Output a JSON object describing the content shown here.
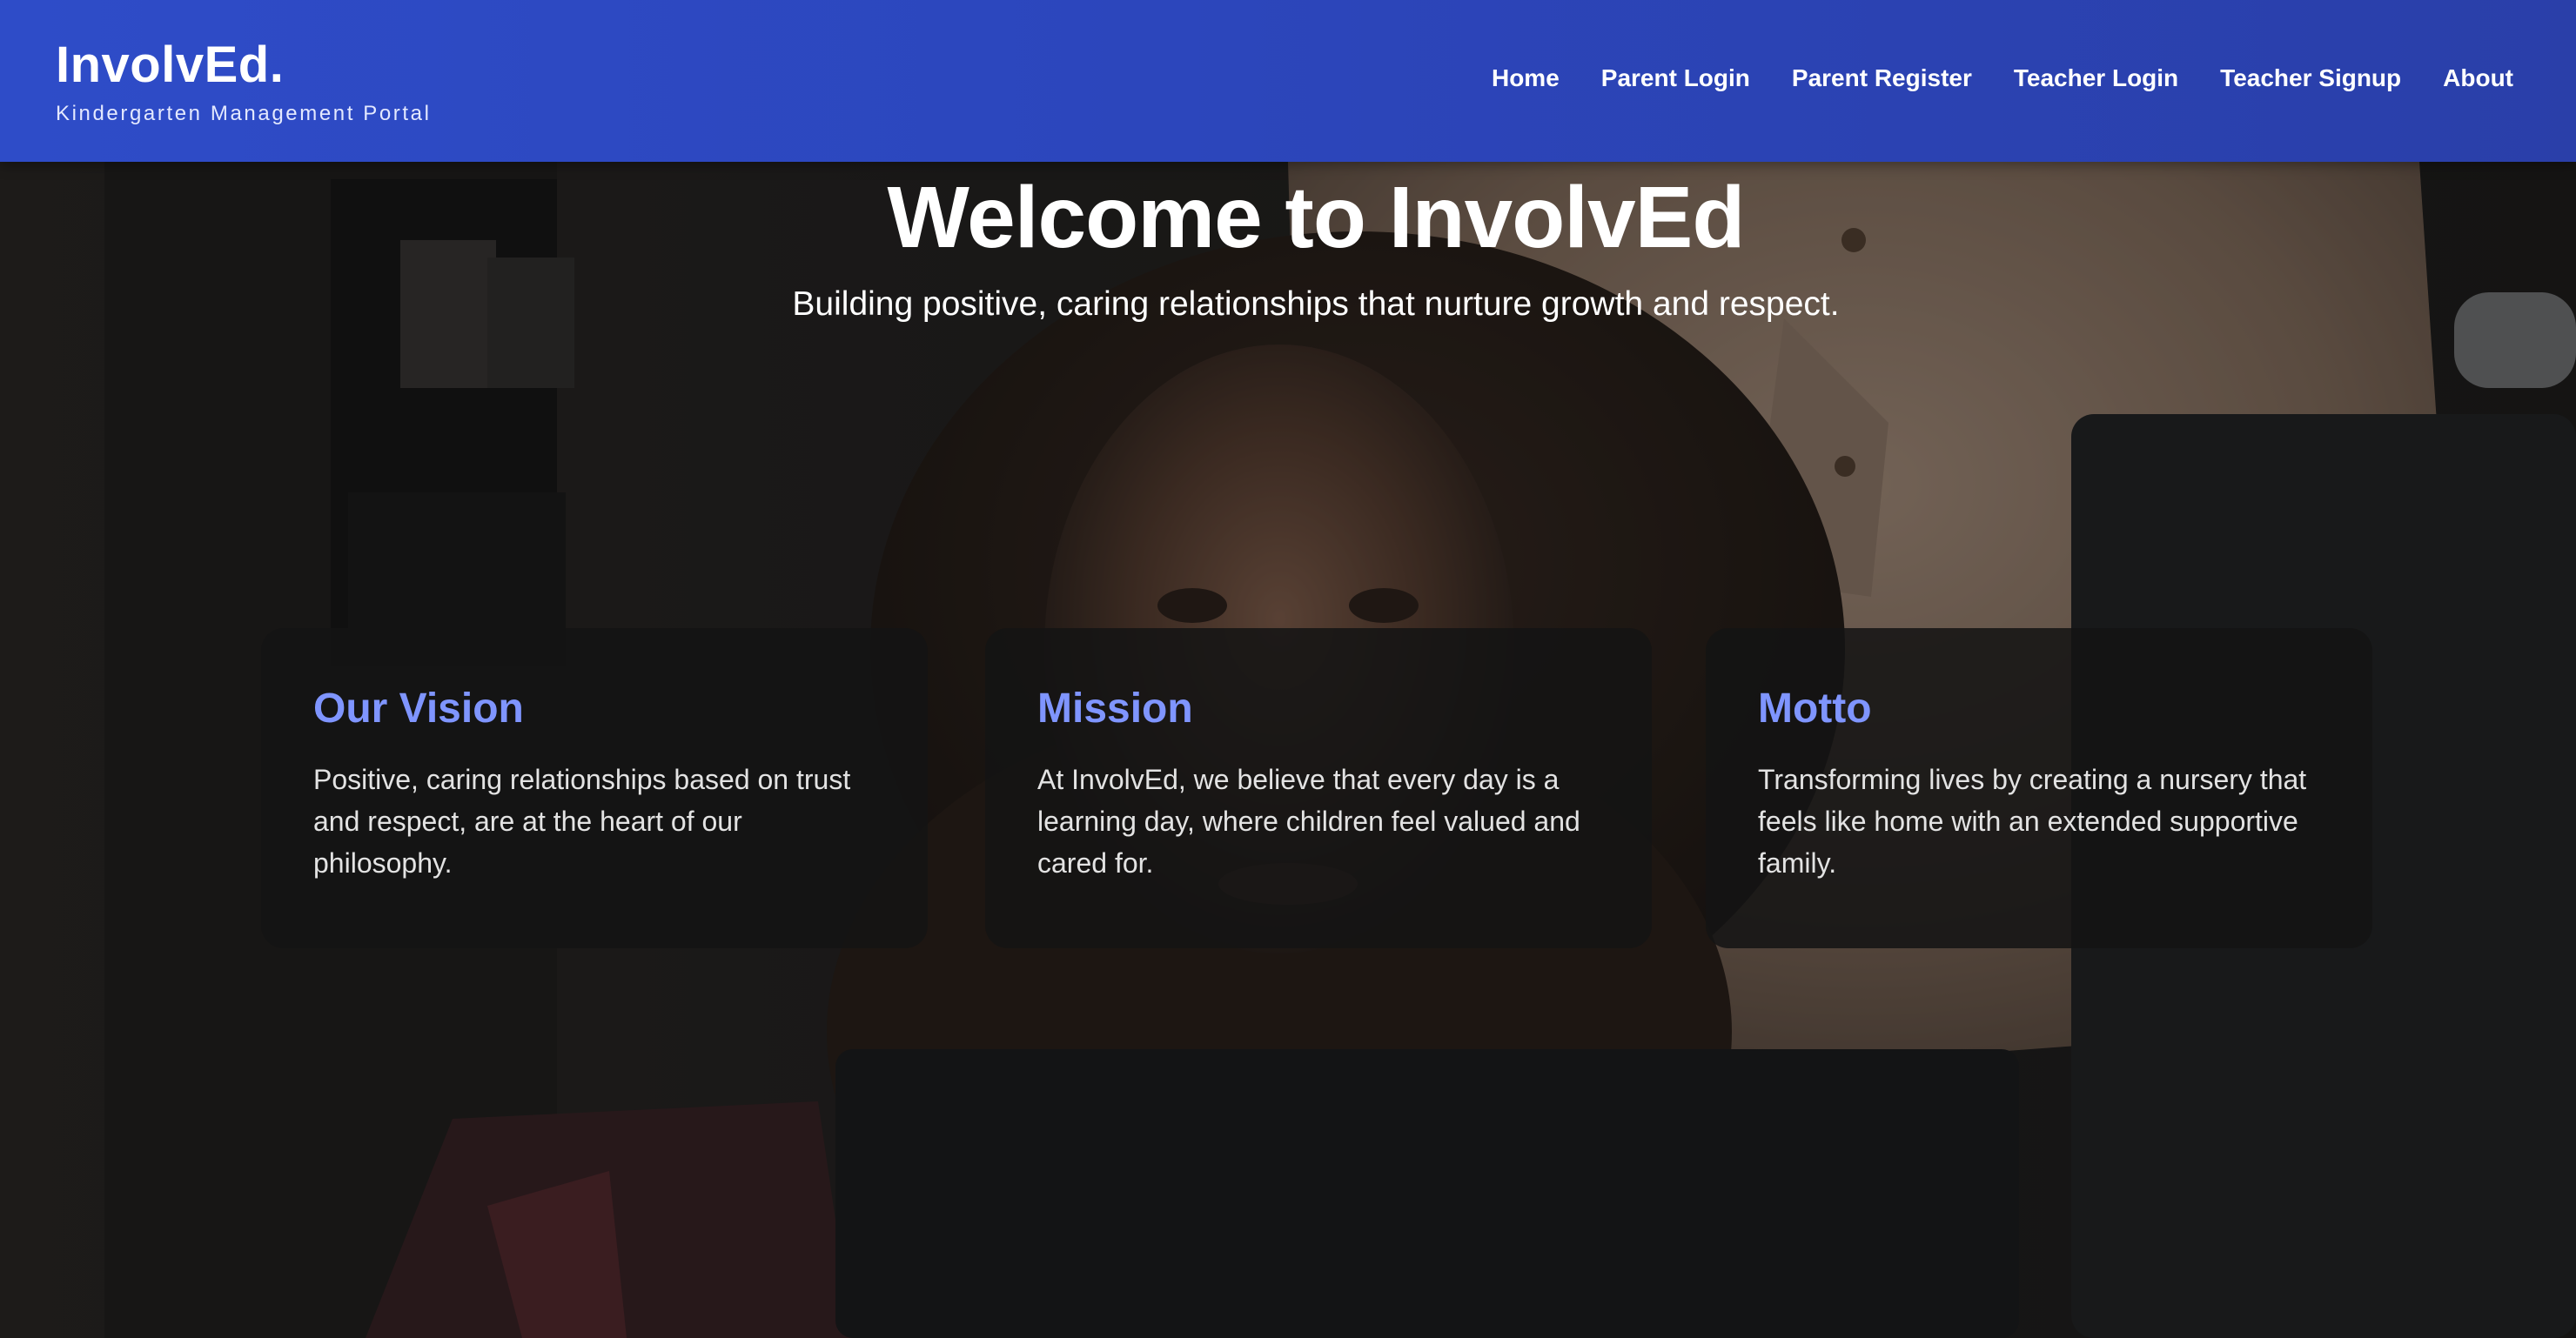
{
  "header": {
    "brand_title": "InvolvEd.",
    "brand_subtitle": "Kindergarten Management Portal",
    "nav": [
      {
        "label": "Home"
      },
      {
        "label": "Parent Login"
      },
      {
        "label": "Parent Register"
      },
      {
        "label": "Teacher Login"
      },
      {
        "label": "Teacher Signup"
      },
      {
        "label": "About"
      }
    ]
  },
  "hero": {
    "title": "Welcome to InvolvEd",
    "subtitle": "Building positive, caring relationships that nurture growth and respect."
  },
  "cards": [
    {
      "title": "Our Vision",
      "text": "Positive, caring relationships based on trust and respect, are at the heart of our philosophy."
    },
    {
      "title": "Mission",
      "text": "At InvolvEd, we believe that every day is a learning day, where children feel valued and cared for."
    },
    {
      "title": "Motto",
      "text": "Transforming lives by creating a nursery that feels like home with an extended supportive family."
    }
  ],
  "colors": {
    "header_blue": "#2e4cc8",
    "card_title_accent": "#7f95ff",
    "card_background": "#141414"
  }
}
